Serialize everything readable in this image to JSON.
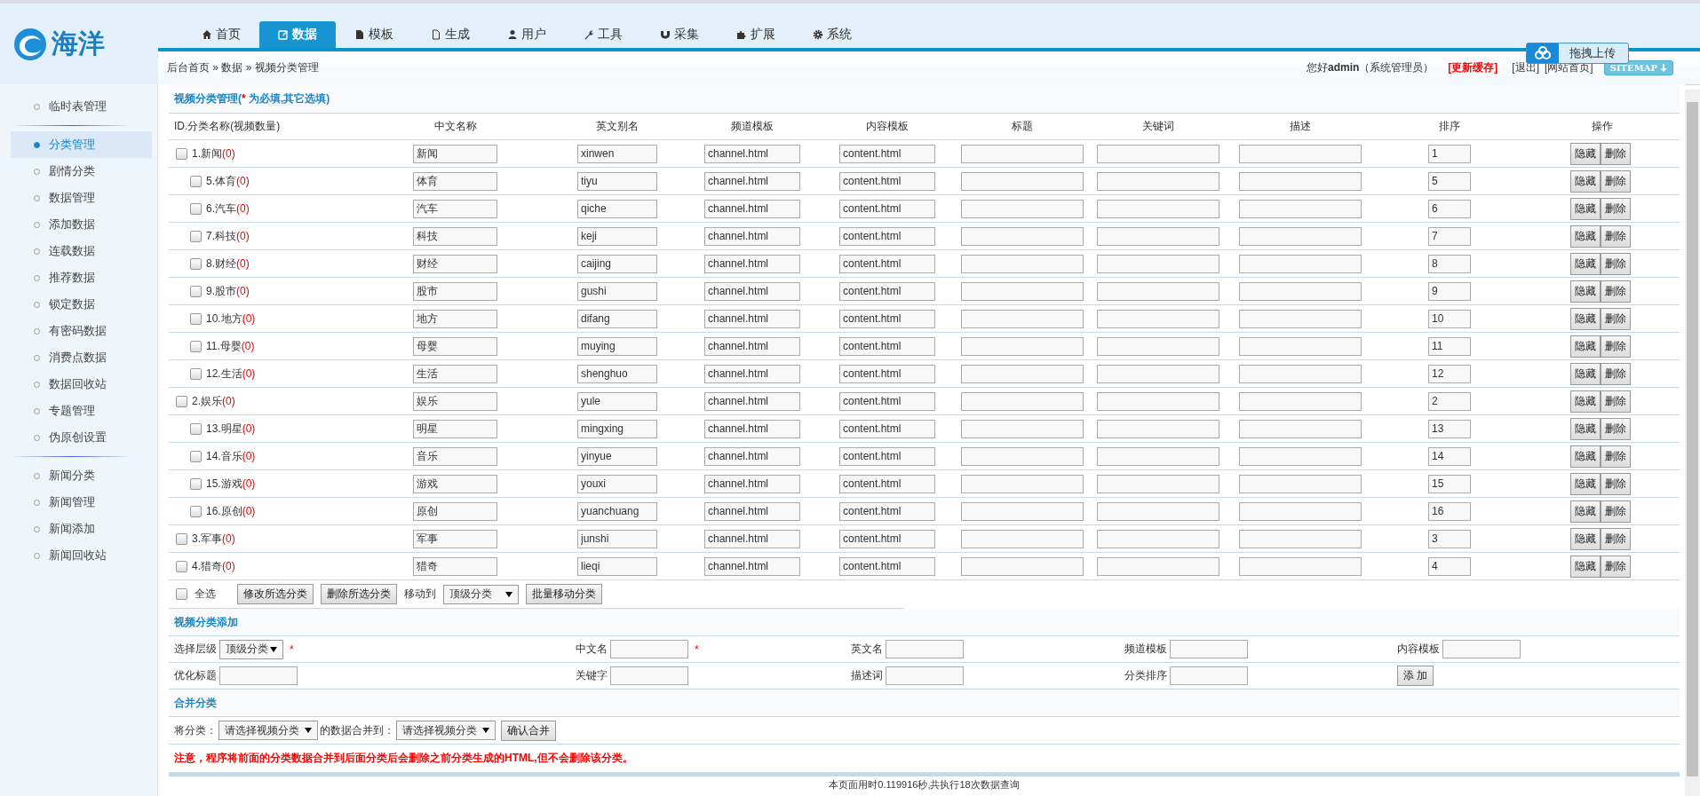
{
  "logo": {
    "text": "海洋"
  },
  "nav_tabs": [
    {
      "label": "首页",
      "selected": false
    },
    {
      "label": "数据",
      "selected": true
    },
    {
      "label": "模板",
      "selected": false
    },
    {
      "label": "生成",
      "selected": false
    },
    {
      "label": "用户",
      "selected": false
    },
    {
      "label": "工具",
      "selected": false
    },
    {
      "label": "采集",
      "selected": false
    },
    {
      "label": "扩展",
      "selected": false
    },
    {
      "label": "系统",
      "selected": false
    }
  ],
  "upload_button": {
    "label": "拖拽上传"
  },
  "breadcrumb": "后台首页 » 数据 » 视频分类管理",
  "user_bar": {
    "greeting": "您好**admin**（系统管理员）",
    "refresh_cache": "[更新缓存]",
    "logout": "[退出]",
    "site_home": "[网站首页]",
    "sitemap": "SITEMAP"
  },
  "sidebar": {
    "groups": [
      [
        {
          "label": "临时表管理",
          "selected": false
        }
      ],
      [
        {
          "label": "分类管理",
          "selected": true
        },
        {
          "label": "剧情分类",
          "selected": false
        },
        {
          "label": "数据管理",
          "selected": false
        },
        {
          "label": "添加数据",
          "selected": false
        },
        {
          "label": "连载数据",
          "selected": false
        },
        {
          "label": "推荐数据",
          "selected": false
        },
        {
          "label": "锁定数据",
          "selected": false
        },
        {
          "label": "有密码数据",
          "selected": false
        },
        {
          "label": "消费点数据",
          "selected": false
        },
        {
          "label": "数据回收站",
          "selected": false
        },
        {
          "label": "专题管理",
          "selected": false
        },
        {
          "label": "伪原创设置",
          "selected": false
        }
      ],
      [
        {
          "label": "新闻分类",
          "selected": false
        },
        {
          "label": "新闻管理",
          "selected": false
        },
        {
          "label": "新闻添加",
          "selected": false
        },
        {
          "label": "新闻回收站",
          "selected": false
        }
      ]
    ]
  },
  "panel": {
    "title_prefix": "视频分类管理(",
    "required_mark": "*",
    "title_suffix": " 为必填,其它选填)"
  },
  "table": {
    "columns": [
      "ID.分类名称(视频数量)",
      "中文名称",
      "英文别名",
      "频道模板",
      "内容模板",
      "标题",
      "关键词",
      "描述",
      "排序",
      "操作"
    ],
    "rows": [
      {
        "label": "1.新闻",
        "count": "(0)",
        "checked": false,
        "name": "新闻",
        "alias": "xinwen",
        "channel_template": "channel.html",
        "content_template": "content.html",
        "sort": "1",
        "actions": [
          "隐藏",
          "删除"
        ],
        "children": [
          {
            "label": "5.体育",
            "count": "(0)",
            "checked": false,
            "name": "体育",
            "alias": "tiyu",
            "channel_template": "channel.html",
            "content_template": "content.html",
            "sort": "5",
            "actions": [
              "隐藏",
              "删除"
            ]
          },
          {
            "label": "6.汽车",
            "count": "(0)",
            "checked": false,
            "name": "汽车",
            "alias": "qiche",
            "channel_template": "channel.html",
            "content_template": "content.html",
            "sort": "6",
            "actions": [
              "隐藏",
              "删除"
            ]
          },
          {
            "label": "7.科技",
            "count": "(0)",
            "checked": false,
            "name": "科技",
            "alias": "keji",
            "channel_template": "channel.html",
            "content_template": "content.html",
            "sort": "7",
            "actions": [
              "隐藏",
              "删除"
            ]
          },
          {
            "label": "8.财经",
            "count": "(0)",
            "checked": false,
            "name": "财经",
            "alias": "caijing",
            "channel_template": "channel.html",
            "content_template": "content.html",
            "sort": "8",
            "actions": [
              "隐藏",
              "删除"
            ]
          },
          {
            "label": "9.股市",
            "count": "(0)",
            "checked": false,
            "name": "股市",
            "alias": "gushi",
            "channel_template": "channel.html",
            "content_template": "content.html",
            "sort": "9",
            "actions": [
              "隐藏",
              "删除"
            ]
          },
          {
            "label": "10.地方",
            "count": "(0)",
            "checked": false,
            "name": "地方",
            "alias": "difang",
            "channel_template": "channel.html",
            "content_template": "content.html",
            "sort": "10",
            "actions": [
              "隐藏",
              "删除"
            ]
          },
          {
            "label": "11.母婴",
            "count": "(0)",
            "checked": false,
            "name": "母婴",
            "alias": "muying",
            "channel_template": "channel.html",
            "content_template": "content.html",
            "sort": "11",
            "actions": [
              "隐藏",
              "删除"
            ]
          },
          {
            "label": "12.生活",
            "count": "(0)",
            "checked": false,
            "name": "生活",
            "alias": "shenghuo",
            "channel_template": "channel.html",
            "content_template": "content.html",
            "sort": "12",
            "actions": [
              "隐藏",
              "删除"
            ]
          }
        ]
      },
      {
        "label": "2.娱乐",
        "count": "(0)",
        "checked": false,
        "name": "娱乐",
        "alias": "yule",
        "channel_template": "channel.html",
        "content_template": "content.html",
        "sort": "2",
        "actions": [
          "隐藏",
          "删除"
        ],
        "children": [
          {
            "label": "13.明星",
            "count": "(0)",
            "checked": false,
            "name": "明星",
            "alias": "mingxing",
            "channel_template": "channel.html",
            "content_template": "content.html",
            "sort": "13",
            "actions": [
              "隐藏",
              "删除"
            ]
          },
          {
            "label": "14.音乐",
            "count": "(0)",
            "checked": false,
            "name": "音乐",
            "alias": "yinyue",
            "channel_template": "channel.html",
            "content_template": "content.html",
            "sort": "14",
            "actions": [
              "隐藏",
              "删除"
            ]
          },
          {
            "label": "15.游戏",
            "count": "(0)",
            "checked": false,
            "name": "游戏",
            "alias": "youxi",
            "channel_template": "channel.html",
            "content_template": "content.html",
            "sort": "15",
            "actions": [
              "隐藏",
              "删除"
            ]
          },
          {
            "label": "16.原创",
            "count": "(0)",
            "checked": false,
            "name": "原创",
            "alias": "yuanchuang",
            "channel_template": "channel.html",
            "content_template": "content.html",
            "sort": "16",
            "actions": [
              "隐藏",
              "删除"
            ]
          }
        ]
      },
      {
        "label": "3.军事",
        "count": "(0)",
        "checked": false,
        "name": "军事",
        "alias": "junshi",
        "channel_template": "channel.html",
        "content_template": "content.html",
        "sort": "3",
        "actions": [
          "隐藏",
          "删除"
        ]
      },
      {
        "label": "4.猎奇",
        "count": "(0)",
        "checked": false,
        "name": "猎奇",
        "alias": "lieqi",
        "channel_template": "channel.html",
        "content_template": "content.html",
        "sort": "4",
        "actions": [
          "隐藏",
          "删除"
        ]
      }
    ]
  },
  "bulk_actions": {
    "select_all": {
      "label": "全选",
      "checked": false
    },
    "edit_button": "修改所选分类",
    "delete_button": "删除所选分类",
    "move_label": "移动到",
    "move_select": "顶级分类",
    "move_button": "批量移动分类"
  },
  "add_form": {
    "title": "视频分类添加",
    "fields": [
      {
        "kind": "select",
        "label": "选择层级",
        "value": "顶级分类",
        "required_mark": "*"
      },
      {
        "kind": "input",
        "label": "中文名",
        "required_mark": "*"
      },
      {
        "kind": "input",
        "label": "英文名"
      },
      {
        "kind": "input",
        "label": "频道模板"
      },
      {
        "kind": "input",
        "label": "内容模板"
      },
      {
        "kind": "input",
        "label": "优化标题"
      },
      {
        "kind": "input",
        "label": "关键字"
      },
      {
        "kind": "input",
        "label": "描述词"
      },
      {
        "kind": "input",
        "label": "分类排序"
      },
      {
        "kind": "button",
        "label": "添 加"
      }
    ]
  },
  "merge": {
    "title": "合并分类",
    "from_label": "将分类：",
    "from_select": "请选择视频分类",
    "to_label": "的数据合并到：",
    "to_select": "请选择视频分类",
    "confirm_button": "确认合并",
    "notice": "注意，程序将前面的分类数据合并到后面分类后会删除之前分类生成的HTML,但不会删除该分类。"
  },
  "footer": "本页面用时0.119916秒,共执行18次数据查询"
}
